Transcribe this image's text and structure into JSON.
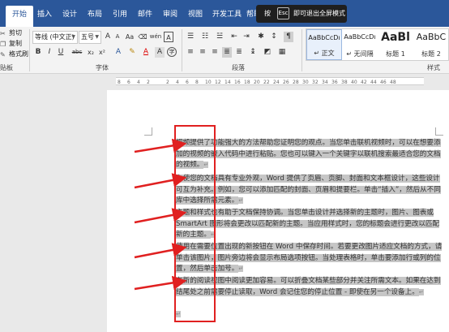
{
  "tabs": [
    "开始",
    "插入",
    "设计",
    "布局",
    "引用",
    "邮件",
    "审阅",
    "视图",
    "开发工具",
    "帮助"
  ],
  "toast": {
    "prefix": "按",
    "key": "Esc",
    "message": "即可退出全屏模式"
  },
  "clipboard": {
    "cut": "剪切",
    "copy": "复制",
    "format_painter": "格式刷",
    "label": "贴板"
  },
  "font": {
    "name": "等线 (中文正)",
    "size": "五号",
    "label": "字体",
    "buttons": {
      "bold": "B",
      "italic": "I",
      "underline": "U",
      "strike": "abc",
      "sub": "x₂",
      "sup": "x²",
      "grow": "A",
      "shrink": "A",
      "case": "Aa",
      "phonetic": "wén",
      "border": "A"
    }
  },
  "paragraph": {
    "label": "段落"
  },
  "styles": {
    "label": "样式",
    "items": [
      {
        "preview": "AaBbCcDı",
        "name": "↵ 正文"
      },
      {
        "preview": "AaBbCcDı",
        "name": "↵ 无间隔"
      },
      {
        "preview": "AaBl",
        "name": "标题 1"
      },
      {
        "preview": "AaBbC",
        "name": "标题 2"
      }
    ]
  },
  "ruler": {
    "numbers": [
      "8",
      "6",
      "4",
      "2",
      "2",
      "4",
      "6",
      "8",
      "10",
      "12",
      "14",
      "16",
      "18",
      "20",
      "22",
      "24",
      "26",
      "28",
      "30",
      "32",
      "34",
      "36",
      "38",
      "40",
      "42",
      "44",
      "46",
      "48"
    ]
  },
  "document": {
    "paragraphs": [
      "视频提供了功能强大的方法帮助您证明您的观点。当您单击联机视频时，可以在想要添加的视频的嵌入代码中进行粘贴。您也可以键入一个关键字以联机搜索最适合您的文档的视频。",
      "为使您的文档具有专业外观，Word 提供了页眉、页脚、封面和文本框设计，这些设计可互为补充。例如，您可以添加匹配的封面、页眉和提要栏。单击“插入”，然后从不同库中选择所需元素。",
      "主题和样式也有助于文档保持协调。当您单击设计并选择新的主题时，图片、图表或 SmartArt 图形将会更改以匹配新的主题。当应用样式时，您的标题会进行更改以匹配新的主题。",
      "使用在需要位置出现的新按钮在 Word 中保存时间。若要更改图片适应文档的方式，请单击该图片，图片旁边将会显示布局选项按钮。当处理表格时，单击要添加行或列的位置，然后单击加号。",
      "在新的阅读视图中阅读更加容易。可以折叠文档某些部分并关注所需文本。如果在达到结尾处之前需要停止读取，Word 会记住您的停止位置 - 即使在另一个设备上。"
    ],
    "paragraph_mark": "↵"
  },
  "colors": {
    "ribbon_blue": "#2b579a",
    "highlight_gray": "#c6c6c6",
    "annotation_red": "#e02020"
  }
}
